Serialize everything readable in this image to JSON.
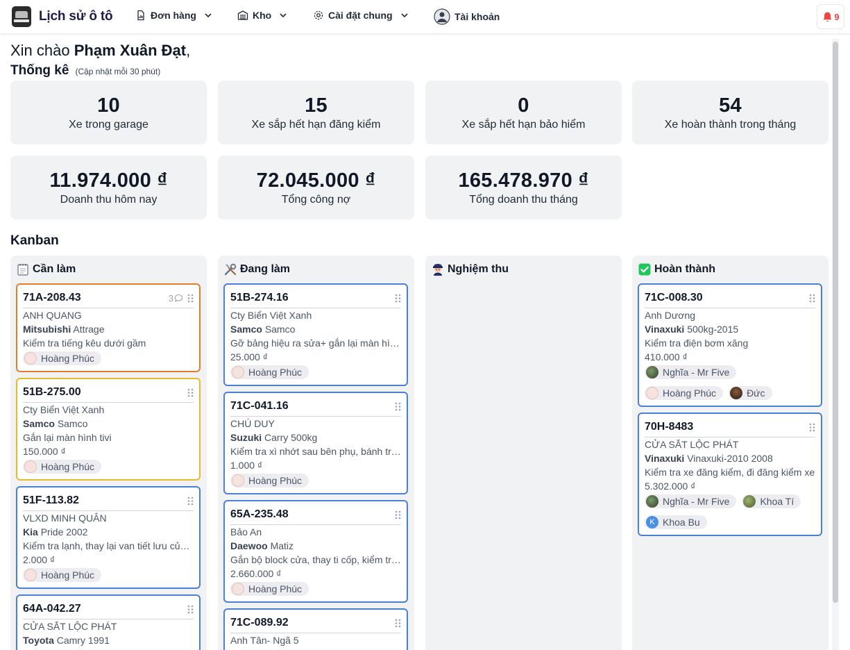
{
  "app": {
    "title": "Lịch sử ô tô"
  },
  "nav": [
    {
      "label": "Đơn hàng",
      "icon": "document-chart-icon",
      "has_menu": true
    },
    {
      "label": "Kho",
      "icon": "warehouse-icon",
      "has_menu": true
    },
    {
      "label": "Cài đặt chung",
      "icon": "gear-icon",
      "has_menu": true
    },
    {
      "label": "Tài khoản",
      "icon": "user-avatar-icon",
      "has_menu": false
    }
  ],
  "notifications": {
    "count": "9",
    "icon": "bell-icon",
    "color": "#ef4444"
  },
  "greeting": {
    "prefix": "Xin chào",
    "name": "Phạm Xuân Đạt",
    "suffix": ","
  },
  "stats": {
    "title": "Thống kê",
    "subtitle": "(Cập nhật mỗi 30 phút)",
    "cards": [
      {
        "value": "10",
        "label": "Xe trong garage"
      },
      {
        "value": "15",
        "label": "Xe sắp hết hạn đăng kiểm"
      },
      {
        "value": "0",
        "label": "Xe sắp hết hạn bảo hiểm"
      },
      {
        "value": "54",
        "label": "Xe hoàn thành trong tháng"
      },
      {
        "value": "11.974.000 ₫",
        "label": "Doanh thu hôm nay"
      },
      {
        "value": "72.045.000 ₫",
        "label": "Tổng công nợ"
      },
      {
        "value": "165.478.970 ₫",
        "label": "Tổng doanh thu tháng"
      }
    ]
  },
  "kanban": {
    "title": "Kanban",
    "columns": [
      {
        "title": "Cần làm",
        "icon": "notepad-icon",
        "cards": [
          {
            "plate": "71A-208.43",
            "comments": "3",
            "customer": "ANH QUANG",
            "brand": "Mitsubishi",
            "model": "Attrage",
            "task": "Kiểm tra tiếng kêu dưới gầm",
            "price": "",
            "assignees": [
              "Hoàng Phúc"
            ],
            "border": "#ea7a2c"
          },
          {
            "plate": "51B-275.00",
            "comments": "",
            "customer": "Cty Biển Việt Xanh",
            "brand": "Samco",
            "model": "Samco",
            "task": "Gắn lại màn hình tivi",
            "price": "150.000 ₫",
            "assignees": [
              "Hoàng Phúc"
            ],
            "border": "#e8b92a"
          },
          {
            "plate": "51F-113.82",
            "comments": "",
            "customer": "VLXD MINH QUÂN",
            "brand": "Kia",
            "model": "Pride 2002",
            "task": "Kiểm tra lạnh, thay lại van tiết lưu của lốc lạnh",
            "price": "2.000 ₫",
            "assignees": [
              "Hoàng Phúc"
            ],
            "border": "#4a7fd4"
          },
          {
            "plate": "64A-042.27",
            "comments": "",
            "customer": "CỬA SẮT LỘC PHÁT",
            "brand": "Toyota",
            "model": "Camry 1991",
            "task": "",
            "price": "",
            "assignees": [],
            "border": "#4a7fd4"
          }
        ]
      },
      {
        "title": "Đang làm",
        "icon": "tools-icon",
        "cards": [
          {
            "plate": "51B-274.16",
            "comments": "",
            "customer": "Cty Biển Việt Xanh",
            "brand": "Samco",
            "model": "Samco",
            "task": "Gỡ bảng hiệu ra sửa+ gắn lại màn hình tivi",
            "price": "25.000 ₫",
            "assignees": [
              "Hoàng Phúc"
            ],
            "border": "#4a7fd4"
          },
          {
            "plate": "71C-041.16",
            "comments": "",
            "customer": "CHÚ DUY",
            "brand": "Suzuki",
            "model": "Carry 500kg",
            "task": "Kiểm tra xì nhớt sau bên phụ, bánh trước",
            "price": "1.000 ₫",
            "assignees": [
              "Hoàng Phúc"
            ],
            "border": "#4a7fd4"
          },
          {
            "plate": "65A-235.48",
            "comments": "",
            "customer": "Bảo An",
            "brand": "Daewoo",
            "model": "Matiz",
            "task": "Gắn bộ block cửa, thay ti cốp, kiểm tra đèn",
            "price": "2.660.000 ₫",
            "assignees": [
              "Hoàng Phúc"
            ],
            "border": "#4a7fd4"
          },
          {
            "plate": "71C-089.92",
            "comments": "",
            "customer": "Anh Tân- Ngã 5",
            "brand": "",
            "model": "",
            "task": "",
            "price": "",
            "assignees": [],
            "border": "#4a7fd4"
          }
        ]
      },
      {
        "title": "Nghiệm thu",
        "icon": "inspector-icon",
        "cards": []
      },
      {
        "title": "Hoàn thành",
        "icon": "check-mark-icon",
        "cards": [
          {
            "plate": "71C-008.30",
            "comments": "",
            "customer": "Anh Dương",
            "brand": "Vinaxuki",
            "model": "500kg-2015",
            "task": "Kiểm tra điện bơm xăng",
            "price": "410.000 ₫",
            "assignees": [
              "Nghĩa - Mr Five",
              "Hoàng Phúc",
              "Đức"
            ],
            "border": "#4a7fd4"
          },
          {
            "plate": "70H-8483",
            "comments": "",
            "customer": "CỬA SẮT LỘC PHÁT",
            "brand": "Vinaxuki",
            "model": "Vinaxuki-2010 2008",
            "task": "Kiểm tra xe đăng kiểm, đi đăng kiểm xe",
            "price": "5.302.000 ₫",
            "assignees": [
              "Nghĩa - Mr Five",
              "Khoa Tí",
              "Khoa Bu"
            ],
            "border": "#4a7fd4"
          }
        ]
      }
    ]
  }
}
